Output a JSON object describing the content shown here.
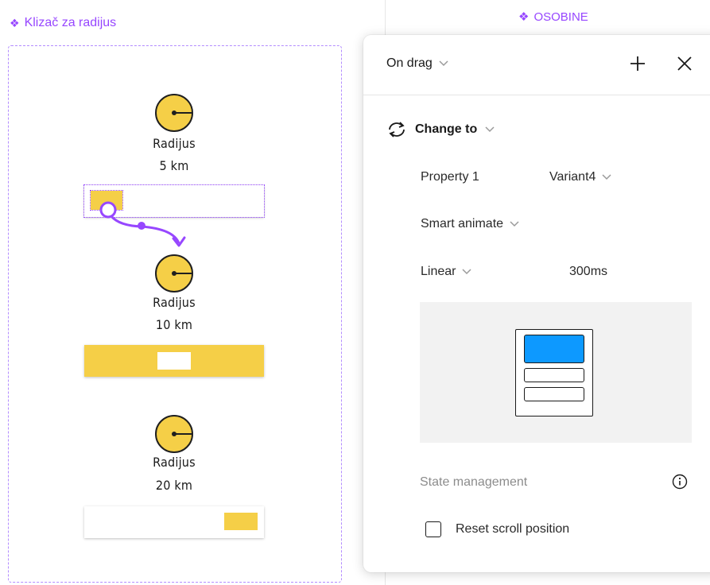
{
  "canvas": {
    "component_label": "Klizač za radijus",
    "variants": [
      {
        "title": "Radijus",
        "value": "5 km",
        "thumb_position": "left",
        "selected": true
      },
      {
        "title": "Radijus",
        "value": "10 km",
        "thumb_position": "center",
        "selected": false
      },
      {
        "title": "Radijus",
        "value": "20 km",
        "thumb_position": "right",
        "selected": false
      }
    ],
    "properties_label": "OSOBINE",
    "colors": {
      "accent": "#9747ff",
      "slider_yellow": "#f5cf47"
    }
  },
  "panel": {
    "trigger": "On drag",
    "action": "Change to",
    "property_name": "Property 1",
    "property_value": "Variant4",
    "animation": "Smart animate",
    "easing": "Linear",
    "duration": "300ms",
    "state_management_label": "State management",
    "reset_scroll_label": "Reset scroll position",
    "reset_scroll_checked": false,
    "icons": [
      "chevron-down-icon",
      "plus-icon",
      "close-icon",
      "swap-icon",
      "info-icon"
    ],
    "preview_accent": "#0d99ff"
  }
}
